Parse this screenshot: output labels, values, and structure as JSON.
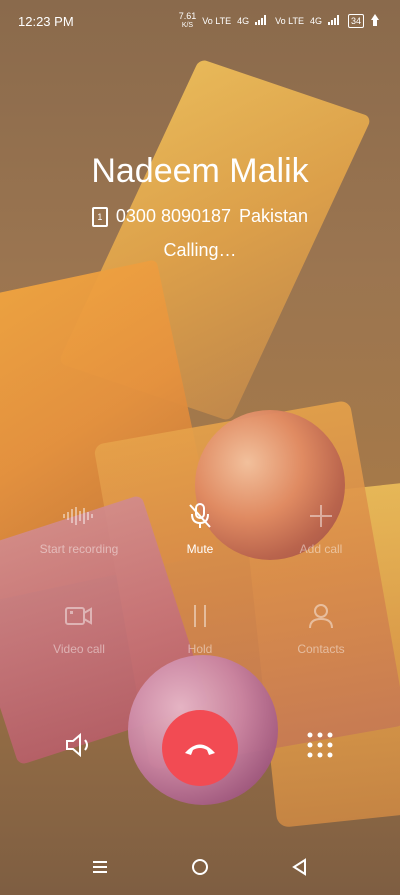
{
  "status": {
    "time": "12:23 PM",
    "net_speed": "7.61",
    "net_unit": "K/S",
    "volte1": "Vo LTE",
    "signal1": "4G",
    "volte2": "Vo LTE",
    "signal2": "4G",
    "battery": "34"
  },
  "contact": {
    "name": "Nadeem Malik",
    "sim": "1",
    "number": "0300 8090187",
    "country": "Pakistan",
    "call_status": "Calling…"
  },
  "controls": {
    "start_recording": "Start recording",
    "mute": "Mute",
    "add_call": "Add call",
    "video_call": "Video call",
    "hold": "Hold",
    "contacts": "Contacts"
  },
  "colors": {
    "end_call": "#f24b53"
  }
}
